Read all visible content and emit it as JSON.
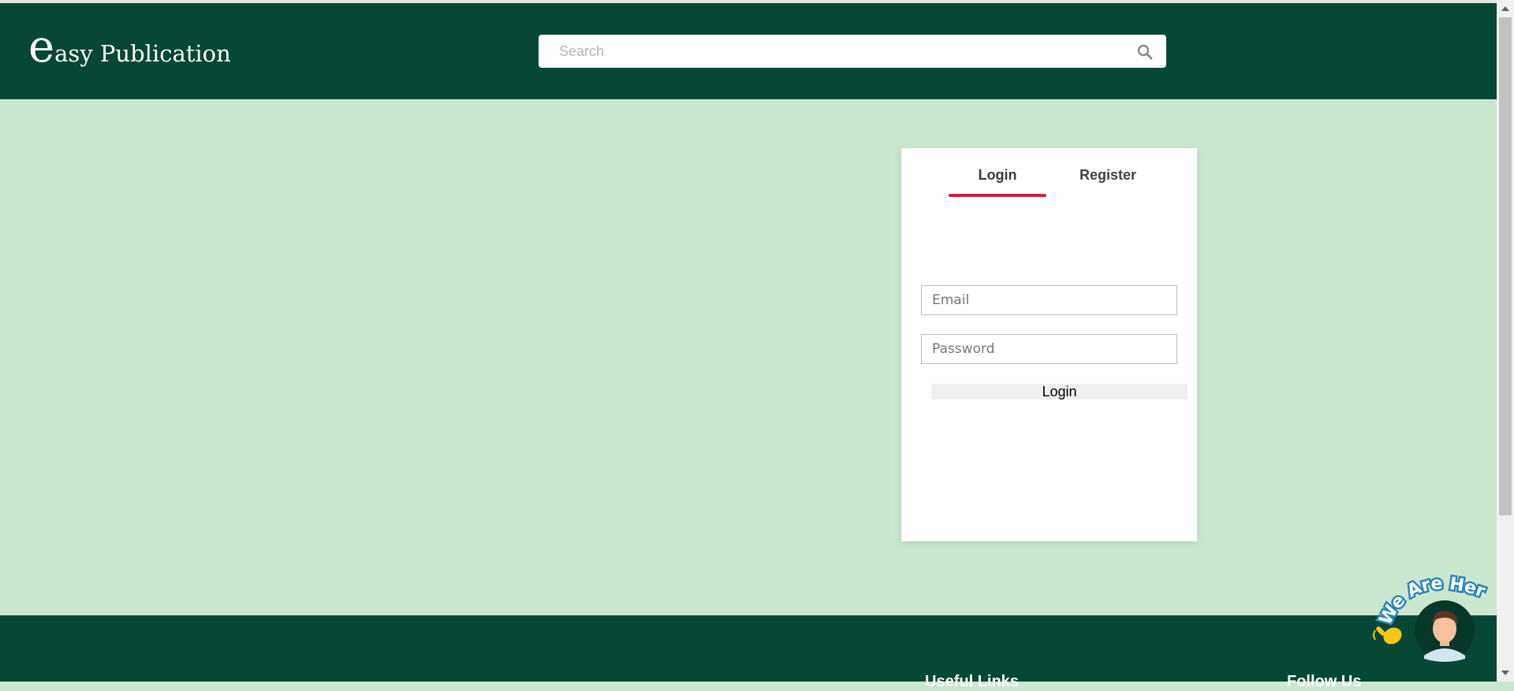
{
  "header": {
    "logo_first_letter": "e",
    "logo_rest": "asy Publication",
    "search_placeholder": "Search",
    "search_icon": "search-icon"
  },
  "auth": {
    "tabs": [
      {
        "label": "Login",
        "active": true
      },
      {
        "label": "Register",
        "active": false
      }
    ],
    "email_placeholder": "Email",
    "password_placeholder": "Password",
    "submit_label": "Login"
  },
  "footer": {
    "headings": [
      "Useful Links",
      "Follow Us"
    ]
  },
  "chat_widget": {
    "text": "We Are Here!",
    "icons": [
      "waving-hand-icon",
      "agent-avatar-icon"
    ]
  },
  "colors": {
    "header_bg": "#074735",
    "page_bg": "#cce7d0",
    "active_tab_accent": "#e0193f"
  }
}
